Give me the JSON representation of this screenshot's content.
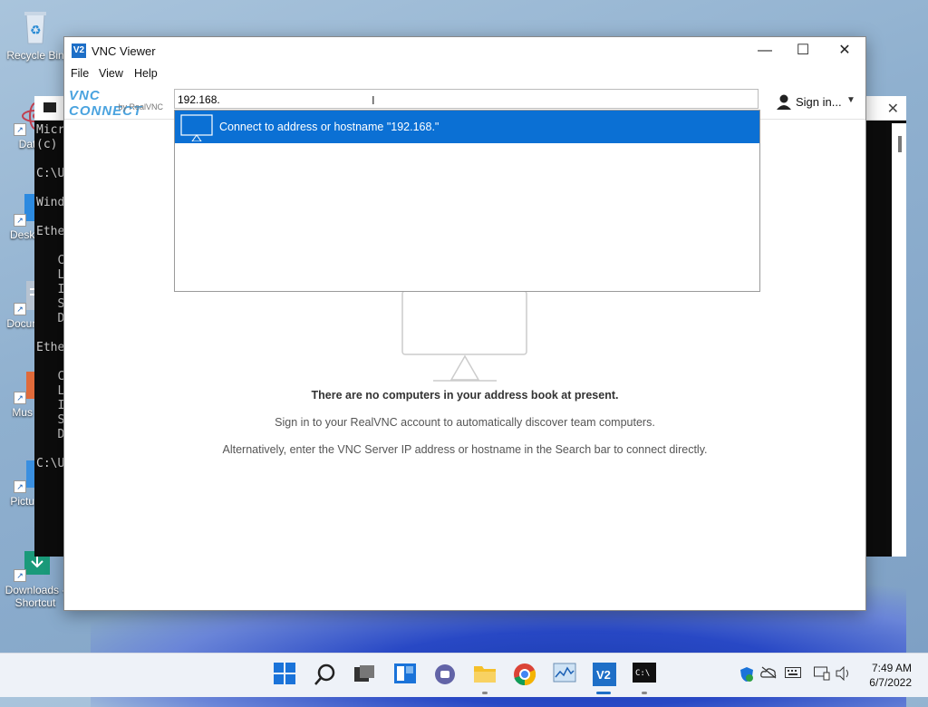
{
  "desktop": {
    "icons": [
      {
        "label": "Recycle Bin"
      },
      {
        "label": "DataW"
      },
      {
        "label": "Desk Shor"
      },
      {
        "label": "Docun Shor"
      },
      {
        "label": "Mus Shor"
      },
      {
        "label": "Pictu Shor"
      },
      {
        "label": "Downloads - Shortcut"
      }
    ]
  },
  "cmd": {
    "lines": "Micr\n(c)\n\nC:\\U\n\nWind\n\nEthe\n\n   C\n   L\n   I\n   S\n   D\n\nEthe\n\n   C\n   L\n   I\n   S\n   D\n\nC:\\U"
  },
  "vnc": {
    "title": "VNC Viewer",
    "app_icon_text": "V2",
    "menu": {
      "file": "File",
      "view": "View",
      "help": "Help"
    },
    "logo": {
      "main": "VNC CONNECT",
      "sub": "by RealVNC"
    },
    "search": {
      "value": "192.168."
    },
    "signin": {
      "label": "Sign in...",
      "caret": "▼"
    },
    "dropdown": {
      "item_label": "Connect to address or hostname \"192.168.\""
    },
    "empty": {
      "headline": "There are no computers in your address book at present.",
      "line1": "Sign in to your RealVNC account to automatically discover team computers.",
      "line2": "Alternatively, enter the VNC Server IP address or hostname in the Search bar to connect directly."
    },
    "controls": {
      "minimize": "—",
      "maximize": "☐",
      "close": "✕"
    }
  },
  "taskbar": {
    "clock": {
      "time": "7:49 AM",
      "date": "6/7/2022"
    }
  },
  "colors": {
    "accent": "#0b70d4",
    "logo": "#4aa3df"
  }
}
